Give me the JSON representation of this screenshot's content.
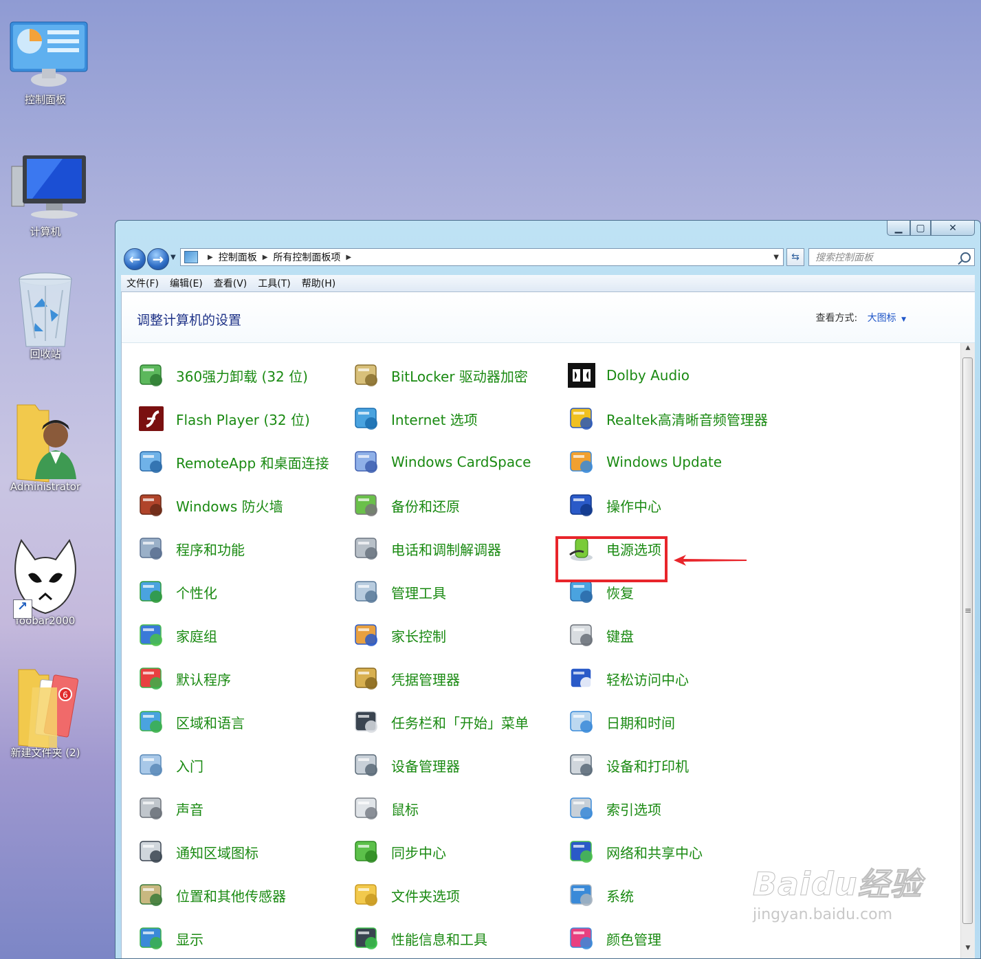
{
  "desktop": {
    "icons": [
      {
        "label": "控制面板"
      },
      {
        "label": "计算机"
      },
      {
        "label": "回收站"
      },
      {
        "label": "Administrator"
      },
      {
        "label": "foobar2000"
      },
      {
        "label": "新建文件夹 (2)",
        "badge": "6"
      }
    ]
  },
  "window": {
    "address": {
      "crumbs": [
        "控制面板",
        "所有控制面板项"
      ]
    },
    "search_placeholder": "搜索控制面板",
    "menu": [
      "文件(F)",
      "编辑(E)",
      "查看(V)",
      "工具(T)",
      "帮助(H)"
    ],
    "page_title": "调整计算机的设置",
    "view_by_label": "查看方式:",
    "view_by_value": "大图标",
    "items": [
      {
        "label": "360强力卸载 (32 位)",
        "icon": "uninstall-icon"
      },
      {
        "label": "BitLocker 驱动器加密",
        "icon": "lock-icon"
      },
      {
        "label": "Dolby Audio",
        "icon": "dolby-icon"
      },
      {
        "label": "Flash Player (32 位)",
        "icon": "flash-icon"
      },
      {
        "label": "Internet 选项",
        "icon": "globe-icon"
      },
      {
        "label": "Realtek高清晰音频管理器",
        "icon": "audio-wave-icon"
      },
      {
        "label": "RemoteApp 和桌面连接",
        "icon": "remote-icon"
      },
      {
        "label": "Windows CardSpace",
        "icon": "cardspace-icon"
      },
      {
        "label": "Windows Update",
        "icon": "update-icon"
      },
      {
        "label": "Windows 防火墙",
        "icon": "firewall-icon"
      },
      {
        "label": "备份和还原",
        "icon": "backup-icon"
      },
      {
        "label": "操作中心",
        "icon": "flag-icon"
      },
      {
        "label": "程序和功能",
        "icon": "programs-icon"
      },
      {
        "label": "电话和调制解调器",
        "icon": "phone-icon"
      },
      {
        "label": "电源选项",
        "icon": "battery-icon"
      },
      {
        "label": "个性化",
        "icon": "personalize-icon"
      },
      {
        "label": "管理工具",
        "icon": "admin-tools-icon"
      },
      {
        "label": "恢复",
        "icon": "recovery-icon"
      },
      {
        "label": "家庭组",
        "icon": "homegroup-icon"
      },
      {
        "label": "家长控制",
        "icon": "parental-icon"
      },
      {
        "label": "键盘",
        "icon": "keyboard-icon"
      },
      {
        "label": "默认程序",
        "icon": "default-programs-icon"
      },
      {
        "label": "凭据管理器",
        "icon": "credential-icon"
      },
      {
        "label": "轻松访问中心",
        "icon": "accessibility-icon"
      },
      {
        "label": "区域和语言",
        "icon": "region-icon"
      },
      {
        "label": "任务栏和「开始」菜单",
        "icon": "taskbar-icon"
      },
      {
        "label": "日期和时间",
        "icon": "calendar-icon"
      },
      {
        "label": "入门",
        "icon": "getting-started-icon"
      },
      {
        "label": "设备管理器",
        "icon": "device-manager-icon"
      },
      {
        "label": "设备和打印机",
        "icon": "printer-icon"
      },
      {
        "label": "声音",
        "icon": "speaker-icon"
      },
      {
        "label": "鼠标",
        "icon": "mouse-icon"
      },
      {
        "label": "索引选项",
        "icon": "index-icon"
      },
      {
        "label": "通知区域图标",
        "icon": "notification-icon"
      },
      {
        "label": "同步中心",
        "icon": "sync-icon"
      },
      {
        "label": "网络和共享中心",
        "icon": "network-icon"
      },
      {
        "label": "位置和其他传感器",
        "icon": "sensor-icon"
      },
      {
        "label": "文件夹选项",
        "icon": "folder-options-icon"
      },
      {
        "label": "系统",
        "icon": "system-icon"
      },
      {
        "label": "显示",
        "icon": "display-icon"
      },
      {
        "label": "性能信息和工具",
        "icon": "performance-icon"
      },
      {
        "label": "颜色管理",
        "icon": "color-icon"
      }
    ]
  },
  "annotation_color": "#e8252b",
  "watermark": {
    "brand": "Baidu经验",
    "url": "jingyan.baidu.com"
  }
}
